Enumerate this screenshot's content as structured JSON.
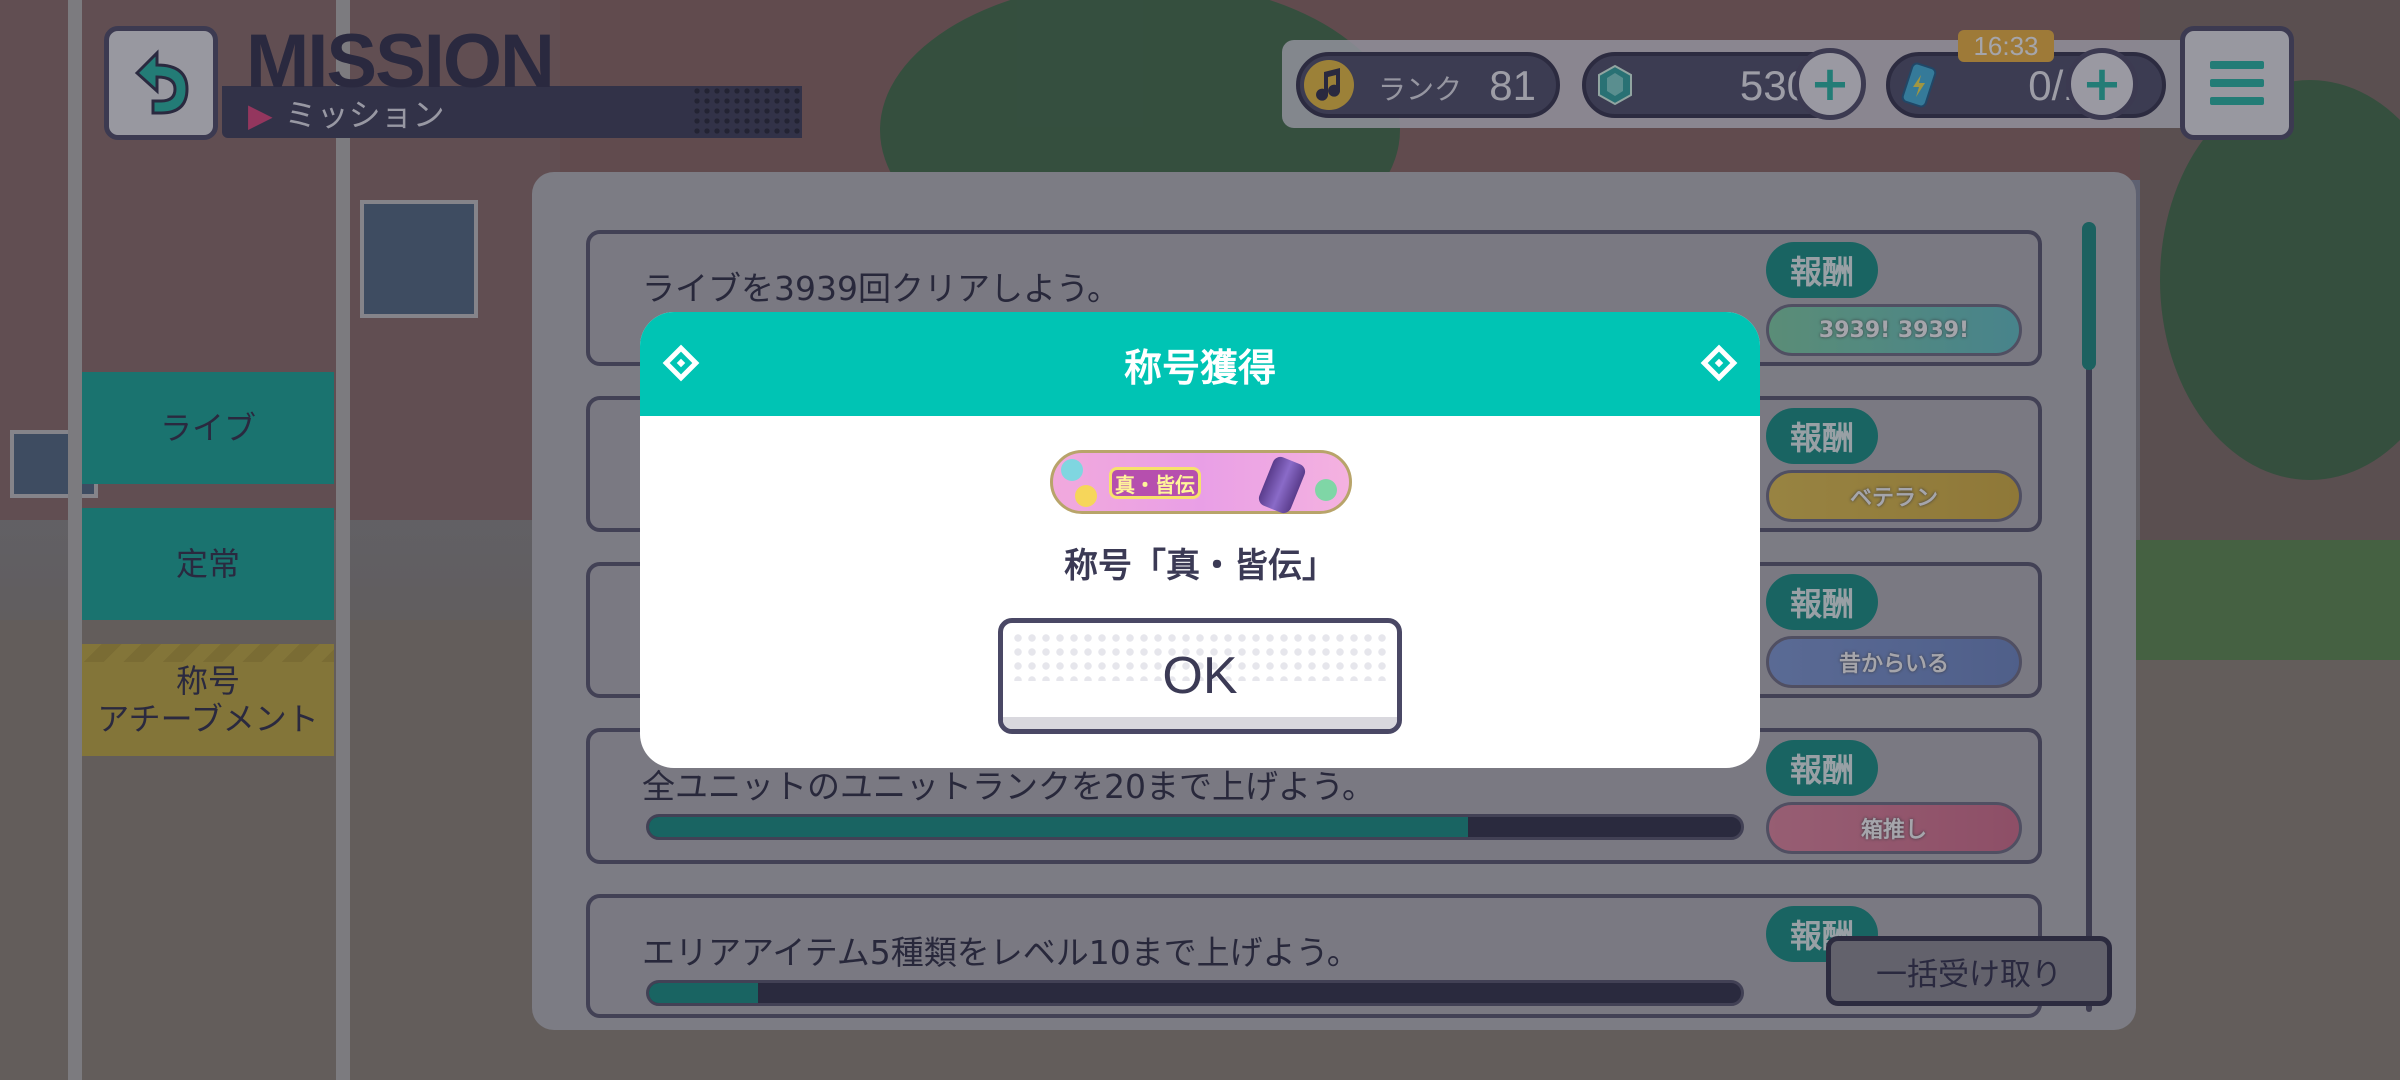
{
  "header": {
    "title_en": "MISSION",
    "title_jp": "ミッション"
  },
  "status": {
    "rank_label": "ランク",
    "rank_value": "81",
    "gems_value": "530",
    "energy_value": "0/10",
    "time": "16:33"
  },
  "tabs": [
    {
      "label": "ライブ"
    },
    {
      "label": "定常"
    },
    {
      "label": "称号\nアチーブメント"
    }
  ],
  "missions": [
    {
      "text": "ライブを3939回クリアしよう。",
      "reward_label": "報酬",
      "reward_title": "3939! 3939!",
      "progress": null
    },
    {
      "text": "",
      "reward_label": "報酬",
      "reward_title": "ベテラン",
      "progress": null
    },
    {
      "text": "",
      "reward_label": "報酬",
      "reward_title": "昔からいる",
      "progress": null
    },
    {
      "text": "全ユニットのユニットランクを20まで上げよう。",
      "reward_label": "報酬",
      "reward_title": "箱推し",
      "progress": 0.75
    },
    {
      "text": "エリアアイテム5種類をレベル10まで上げよう。",
      "reward_label": "報酬",
      "reward_title": "",
      "progress": 0.1
    }
  ],
  "bulk_receive_label": "一括受け取り",
  "modal": {
    "title": "称号獲得",
    "badge_text": "真・皆伝",
    "message": "称号「真・皆伝」",
    "ok_label": "OK"
  },
  "colors": {
    "accent": "#00c4b4",
    "tab_active": "#10a998",
    "tab_title": "#c4ad3b",
    "panel": "#b9b8bc",
    "text_dark": "#3b3a55"
  },
  "icons": {
    "back": "back-arrow-icon",
    "menu": "hamburger-menu-icon",
    "rank": "music-note-icon",
    "gem": "crystal-gem-icon",
    "energy": "energy-can-icon",
    "plus": "plus-icon"
  }
}
